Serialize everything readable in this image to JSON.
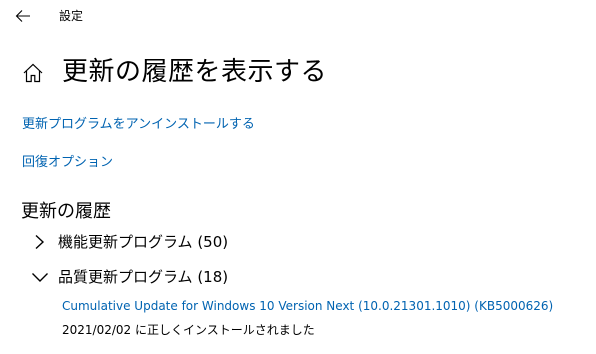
{
  "window": {
    "title": "設定"
  },
  "header": {
    "back_icon": "arrow-left-icon",
    "home_icon": "home-icon",
    "page_title": "更新の履歴を表示する"
  },
  "links": {
    "uninstall": "更新プログラムをアンインストールする",
    "recovery": "回復オプション"
  },
  "history": {
    "section_title": "更新の履歴",
    "groups": [
      {
        "label": "機能更新プログラム (50)",
        "expanded": false,
        "chevron_icon": "chevron-right-icon"
      },
      {
        "label": "品質更新プログラム (18)",
        "expanded": true,
        "chevron_icon": "chevron-down-icon",
        "items": [
          {
            "name": "Cumulative Update for Windows 10 Version Next (10.0.21301.1010) (KB5000626)",
            "status": "2021/02/02 に正しくインストールされました"
          }
        ]
      }
    ]
  },
  "colors": {
    "link": "#0063b1",
    "text": "#000000",
    "background": "#ffffff"
  }
}
